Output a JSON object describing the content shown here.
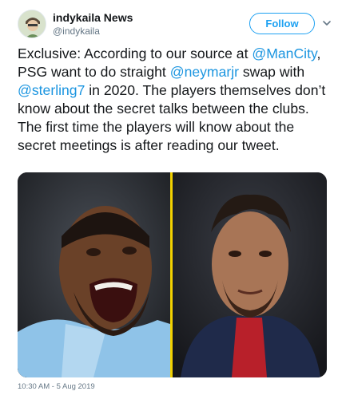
{
  "user": {
    "name": "indykaila News",
    "handle": "@indykaila"
  },
  "follow_label": "Follow",
  "tweet": {
    "segments": [
      {
        "text": "Exclusive: According to our source at ",
        "mention": false
      },
      {
        "text": "@ManCity",
        "mention": true
      },
      {
        "text": ", PSG want to do straight ",
        "mention": false
      },
      {
        "text": "@neymarjr",
        "mention": true
      },
      {
        "text": " swap with ",
        "mention": false
      },
      {
        "text": "@sterling7",
        "mention": true
      },
      {
        "text": " in 2020. The players themselves don’t know about the secret talks between the clubs. The first time the players will know about the secret meetings is after reading our tweet.",
        "mention": false
      }
    ]
  },
  "timestamp": "10:30 AM - 5 Aug 2019",
  "colors": {
    "accent": "#1da1f2",
    "mention": "#1b95e0",
    "divider": "#f2d100"
  }
}
